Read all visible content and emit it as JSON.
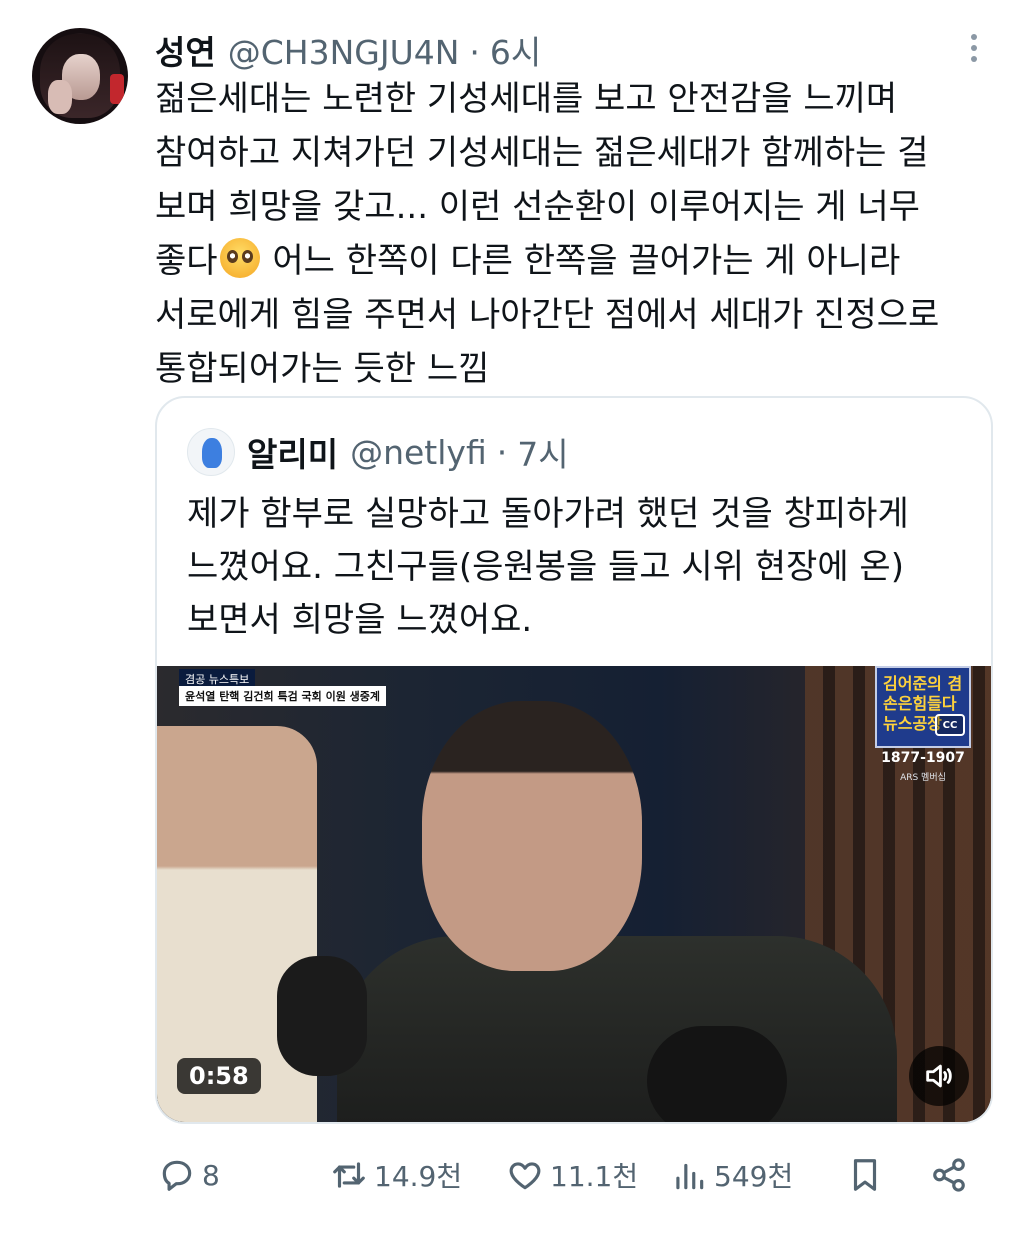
{
  "tweet": {
    "display_name": "성연",
    "handle": "@CH3NGJU4N",
    "separator": "·",
    "time": "6시",
    "lines": [
      "젊은세대는 노련한 기성세대를 보고 안전감을 느끼며",
      "참여하고 지쳐가던 기성세대는 젊은세대가 함께하는 걸",
      "보며 희망을 갖고... 이런 선순환이 이루어지는 게 너무",
      "좋다",
      " 어느 한쪽이 다른 한쪽을 끌어가는 게 아니라",
      "서로에게 힘을 주면서 나아간단 점에서 세대가 진정으로",
      "통합되어가는 듯한 느낌"
    ],
    "emoji_name": "pleading-face-emoji"
  },
  "quote": {
    "display_name": "알리미",
    "handle": "@netlyfi",
    "separator": "·",
    "time": "7시",
    "lines": [
      "제가 함부로 실망하고 돌아가려 했던 것을 창피하게",
      "느꼈어요. 그친구들(응원봉을 들고 시위 현장에 온)",
      "보면서 희망을 느꼈어요."
    ],
    "video": {
      "broadcast_title": "겸공 뉴스특보",
      "broadcast_subtitle": "윤석열 탄핵 김건희 특검 국회 이원 생중계",
      "show_logo": "김어준의 겸손은힘들다 뉴스공장",
      "cc_label": "CC",
      "phone": "1877-1907",
      "ars": "ARS 멤버십",
      "duration": "0:58"
    }
  },
  "actions": {
    "reply_count": "8",
    "retweet_count": "14.9천",
    "like_count": "11.1천",
    "views_count": "549천"
  },
  "colors": {
    "text": "#0f1419",
    "secondary": "#536471",
    "border": "#e1e8ed"
  }
}
